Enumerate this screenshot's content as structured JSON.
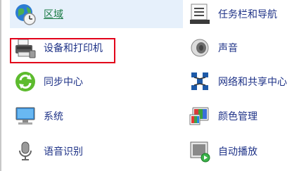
{
  "control_panel": {
    "left_items": [
      {
        "label": "区域",
        "icon": "globe-clock-icon"
      },
      {
        "label": "设备和打印机",
        "icon": "printer-icon"
      },
      {
        "label": "同步中心",
        "icon": "sync-icon"
      },
      {
        "label": "系统",
        "icon": "computer-icon"
      },
      {
        "label": "语音识别",
        "icon": "microphone-icon"
      }
    ],
    "right_items": [
      {
        "label": "任务栏和导航",
        "icon": "taskbar-icon"
      },
      {
        "label": "声音",
        "icon": "speaker-icon"
      },
      {
        "label": "网络和共享中心",
        "icon": "network-icon"
      },
      {
        "label": "颜色管理",
        "icon": "color-management-icon"
      },
      {
        "label": "自动播放",
        "icon": "autoplay-icon"
      }
    ]
  },
  "colors": {
    "highlight_border": "#e2001a",
    "link": "#1e3287",
    "selected_bg": "#e6f0fb"
  }
}
